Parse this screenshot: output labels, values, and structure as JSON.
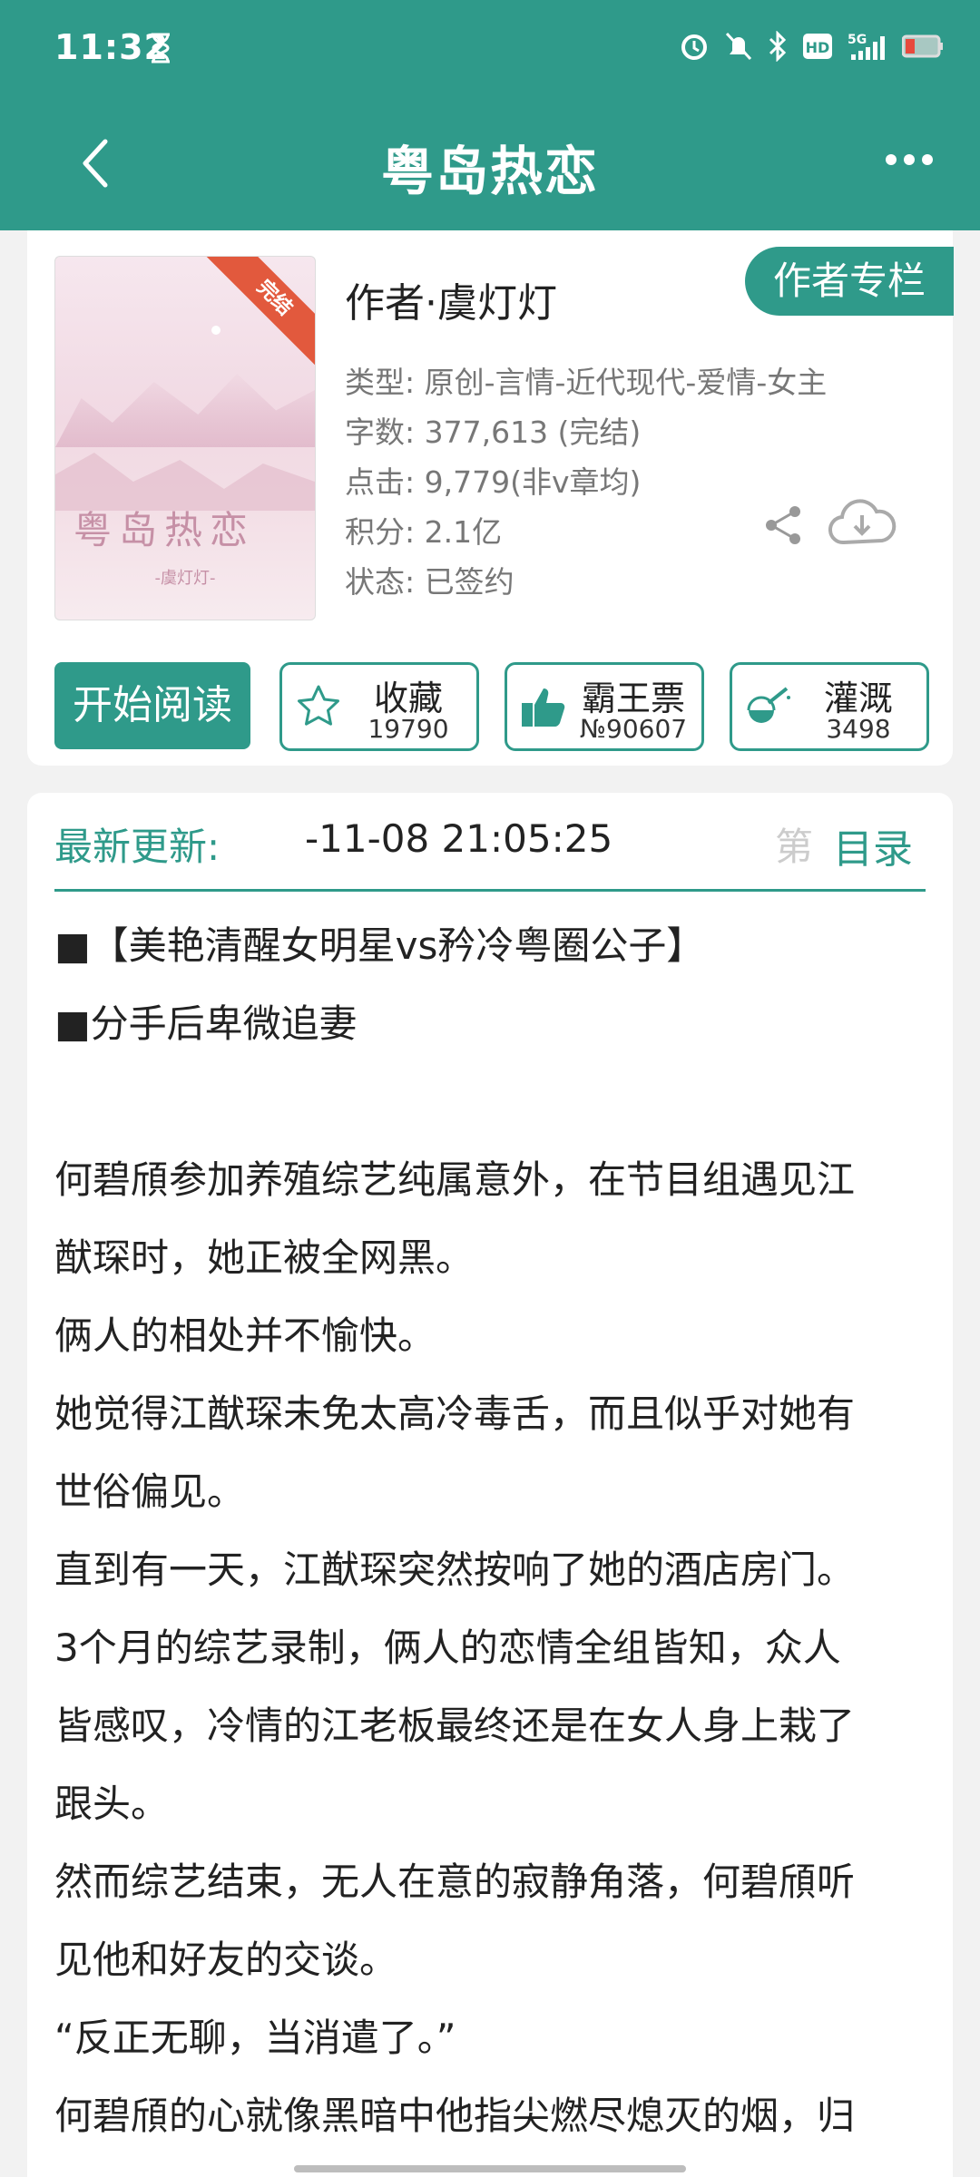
{
  "status_bar": {
    "time": "11:32",
    "icons": [
      "hourglass-icon",
      "alarm-icon",
      "bell-off-icon",
      "bluetooth-icon",
      "hd-icon",
      "signal-5g-icon",
      "battery-icon"
    ]
  },
  "header": {
    "title": "粤岛热恋"
  },
  "book": {
    "cover_title": "粤岛热恋",
    "cover_author": "-虞灯灯-",
    "ribbon": "完结",
    "author_line": "作者·虞灯灯",
    "author_column_label": "作者专栏",
    "meta": [
      "类型: 原创-言情-近代现代-爱情-女主",
      "字数: 377,613 (完结)",
      "点击: 9,779(非v章均)",
      "积分: 2.1亿",
      "状态: 已签约"
    ]
  },
  "actions": {
    "read_label": "开始阅读",
    "favorite": {
      "label": "收藏",
      "count": "19790"
    },
    "bawang": {
      "label": "霸王票",
      "count": "№90607"
    },
    "nutrient": {
      "label": "灌溉",
      "count": "3498"
    }
  },
  "update": {
    "label": "最新更新:",
    "time": "-11-08 21:05:25",
    "chapter_fragment": "第",
    "toc_label": "目录"
  },
  "description": [
    "■【美艳清醒女明星vs矜冷粤圈公子】",
    "■分手后卑微追妻",
    "",
    "何碧頎参加养殖综艺纯属意外，在节目组遇见江",
    "猷琛时，她正被全网黑。",
    "俩人的相处并不愉快。",
    "她觉得江猷琛未免太高冷毒舌，而且似乎对她有",
    "世俗偏见。",
    "直到有一天，江猷琛突然按响了她的酒店房门。",
    "3个月的综艺录制，俩人的恋情全组皆知，众人",
    "皆感叹，冷情的江老板最终还是在女人身上栽了",
    "跟头。",
    "然而综艺结束，无人在意的寂静角落，何碧頎听",
    "见他和好友的交谈。",
    "“反正无聊，当消遣了。”",
    "何碧頎的心就像黑暗中他指尖燃尽熄灭的烟，归"
  ],
  "colors": {
    "accent": "#2f9a8a",
    "ribbon": "#e2593d"
  }
}
